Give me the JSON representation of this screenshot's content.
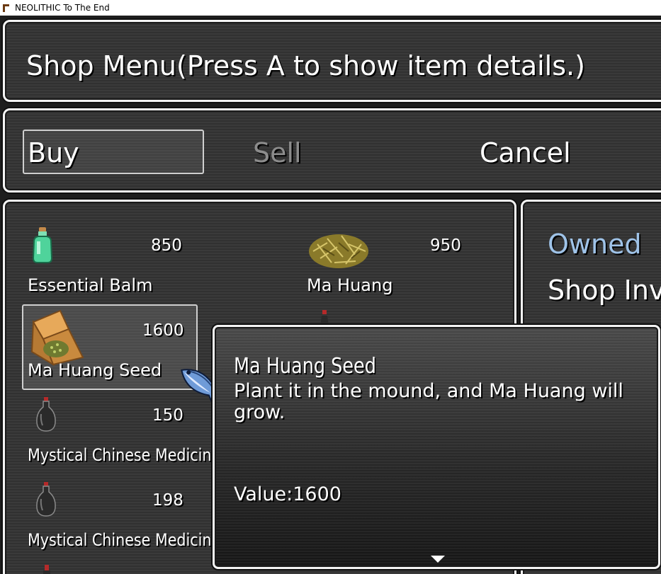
{
  "window": {
    "title": "NEOLITHIC To The End"
  },
  "help": {
    "text": "Shop Menu(Press A to show item details.)"
  },
  "commands": {
    "buy": "Buy",
    "sell": "Sell",
    "cancel": "Cancel",
    "selected": "Buy"
  },
  "items": [
    {
      "name": "Essential Balm",
      "price": "850",
      "icon": "green-bottle-icon"
    },
    {
      "name": "Ma Huang",
      "price": "950",
      "icon": "herb-pile-icon"
    },
    {
      "name": "Ma Huang Seed",
      "price": "1600",
      "icon": "seed-sack-icon",
      "selected": true
    },
    {
      "name": "Mystical Chinese Medicine",
      "price": "150",
      "icon": "black-gourd-icon"
    },
    {
      "name": "Mystical Chinese Medicine",
      "price": "198",
      "icon": "black-gourd-icon"
    }
  ],
  "status": {
    "owned_label": "Owned",
    "shop_label": "Shop Inve"
  },
  "detail": {
    "name": "Ma Huang Seed",
    "description": "Plant it in the mound, and Ma Huang will grow.",
    "value": "Value:1600"
  },
  "cursor": {
    "icon": "fish-cursor-icon"
  },
  "colors": {
    "window_border": "#f4f4f4",
    "owned_label": "#9fc3e8",
    "disabled_text": "#8c8c8c"
  }
}
